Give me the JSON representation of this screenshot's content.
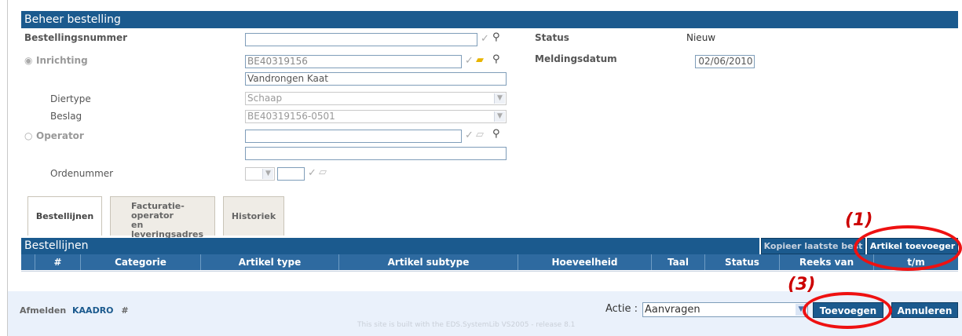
{
  "panel": {
    "title": "Beheer bestelling"
  },
  "form": {
    "bestellingsnummer": {
      "label": "Bestellingsnummer",
      "value": ""
    },
    "inrichting": {
      "label": "Inrichting",
      "value": "BE40319156",
      "name_value": "Vandrongen Kaat"
    },
    "diertype": {
      "label": "Diertype",
      "value": "Schaap"
    },
    "beslag": {
      "label": "Beslag",
      "value": "BE40319156-0501"
    },
    "operator": {
      "label": "Operator",
      "value": "",
      "name_value": ""
    },
    "ordenummer": {
      "label": "Ordenummer",
      "value": ""
    },
    "status": {
      "label": "Status",
      "value": "Nieuw"
    },
    "meldingsdatum": {
      "label": "Meldingsdatum",
      "value": "02/06/2010"
    }
  },
  "tabs": [
    {
      "label": "Bestellijnen"
    },
    {
      "label_lines": [
        "Facturatie-",
        "operator",
        "en leveringsadres"
      ]
    },
    {
      "label": "Historiek"
    }
  ],
  "grid": {
    "title": "Bestellijnen",
    "copy_button": "Kopieer laatste best",
    "add_button": "Artikel toevoeger",
    "columns": [
      "#",
      "Categorie",
      "Artikel type",
      "Artikel subtype",
      "Hoeveelheid",
      "Taal",
      "Status",
      "Reeks van",
      "t/m"
    ]
  },
  "footer": {
    "logout": "Afmelden",
    "user": "KAADRO",
    "hash": "#",
    "action_label": "Actie :",
    "action_value": "Aanvragen",
    "add": "Toevoegen",
    "cancel": "Annuleren",
    "built": "This site is built with the EDS.SystemLib VS2005 - release 8.1"
  },
  "annotations": {
    "one": "(1)",
    "three": "(3)"
  },
  "icons": [
    "check-icon",
    "magnifier-icon",
    "folder-icon",
    "radio-icon",
    "dropdown-arrow-icon"
  ],
  "colors": {
    "header": "#1b5a8e",
    "annotation": "#ee1111"
  }
}
